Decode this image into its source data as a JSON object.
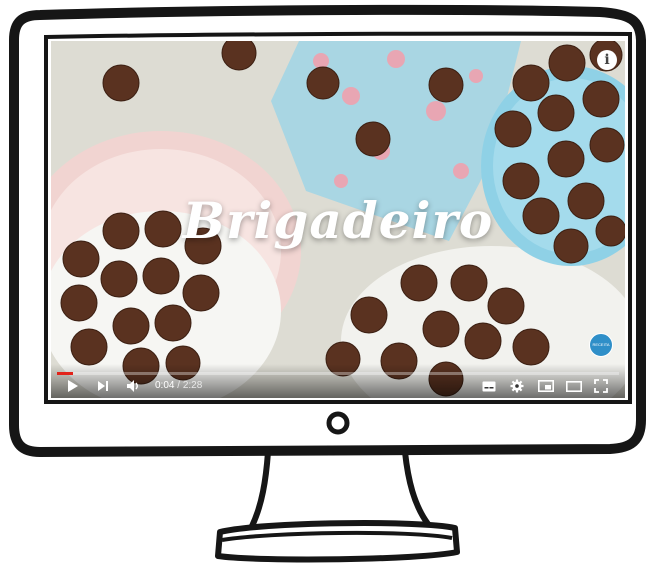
{
  "video": {
    "title_overlay": "Brigadeiro",
    "info_label": "i",
    "channel_badge": "RECEITA",
    "progress": 0.029,
    "time_current": "0:04",
    "time_separator": " / ",
    "time_total": "2:28"
  },
  "controls": {
    "left": [
      "play-icon",
      "next-icon",
      "volume-icon"
    ],
    "right": [
      "subtitles-icon",
      "settings-icon",
      "miniplayer-icon",
      "theater-icon",
      "fullscreen-icon"
    ]
  },
  "colors": {
    "progress": "#e2231a",
    "bezel": "#1a1a1a",
    "plate_blue": "#8fd1e6"
  }
}
